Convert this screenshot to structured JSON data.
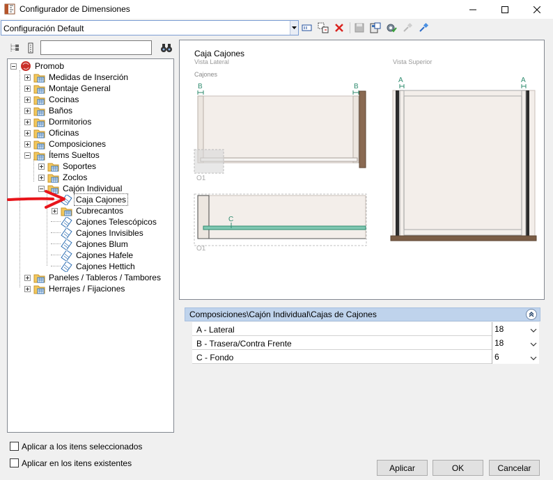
{
  "window": {
    "title": "Configurador de Dimensiones",
    "icon": "ruler-app-icon",
    "controls": [
      "minimize-icon",
      "maximize-icon",
      "close-icon"
    ]
  },
  "toolbar": {
    "config_value": "Configuración Default",
    "icons": [
      "rename-icon",
      "copy-config-icon",
      "delete-x-icon",
      "save-icon",
      "calculator-icon",
      "settings-check-icon",
      "pin-icon",
      "pin-edit-icon"
    ]
  },
  "search": {
    "placeholder": "",
    "tool_icons": [
      "tree-expand-icon",
      "tree-list-icon",
      "binoculars-icon"
    ]
  },
  "tree": {
    "root": "Promob",
    "items": [
      {
        "label": "Medidas de Inserción"
      },
      {
        "label": "Montaje General"
      },
      {
        "label": "Cocinas"
      },
      {
        "label": "Baños"
      },
      {
        "label": "Dormitorios"
      },
      {
        "label": "Oficinas"
      },
      {
        "label": "Composiciones"
      },
      {
        "label": "Ítems Sueltos"
      },
      {
        "label": "Soportes"
      },
      {
        "label": "Zoclos"
      },
      {
        "label": "Cajón Individual"
      },
      {
        "label": "Caja Cajones"
      },
      {
        "label": "Cubrecantos"
      },
      {
        "label": "Cajones Telescópicos"
      },
      {
        "label": "Cajones Invisibles"
      },
      {
        "label": "Cajones Blum"
      },
      {
        "label": "Cajones Hafele"
      },
      {
        "label": "Cajones Hettich"
      },
      {
        "label": "Paneles / Tableros / Tambores"
      },
      {
        "label": "Herrajes / Fijaciones"
      }
    ]
  },
  "preview": {
    "title": "Caja Cajones",
    "lateral_view": "Vista Lateral",
    "top_view": "Vista Superior",
    "section": "Cajones",
    "marker_b": "B",
    "marker_a": "A",
    "marker_c": "C",
    "tag": "O1"
  },
  "params": {
    "path": "Composiciones\\Cajón Individual\\Cajas de Cajones",
    "rows": [
      {
        "label": "A - Lateral",
        "value": "18"
      },
      {
        "label": "B - Trasera/Contra Frente",
        "value": "18"
      },
      {
        "label": "C - Fondo",
        "value": "6"
      }
    ]
  },
  "options": {
    "apply_selected": "Aplicar a los itens seleccionados",
    "apply_existing": "Aplicar en los itens existentes"
  },
  "buttons": {
    "apply": "Aplicar",
    "ok": "OK",
    "cancel": "Cancelar"
  },
  "colors": {
    "accent_green": "#2e8b6e",
    "header_blue": "#bfd3ec",
    "arrow_red": "#e8151b"
  }
}
